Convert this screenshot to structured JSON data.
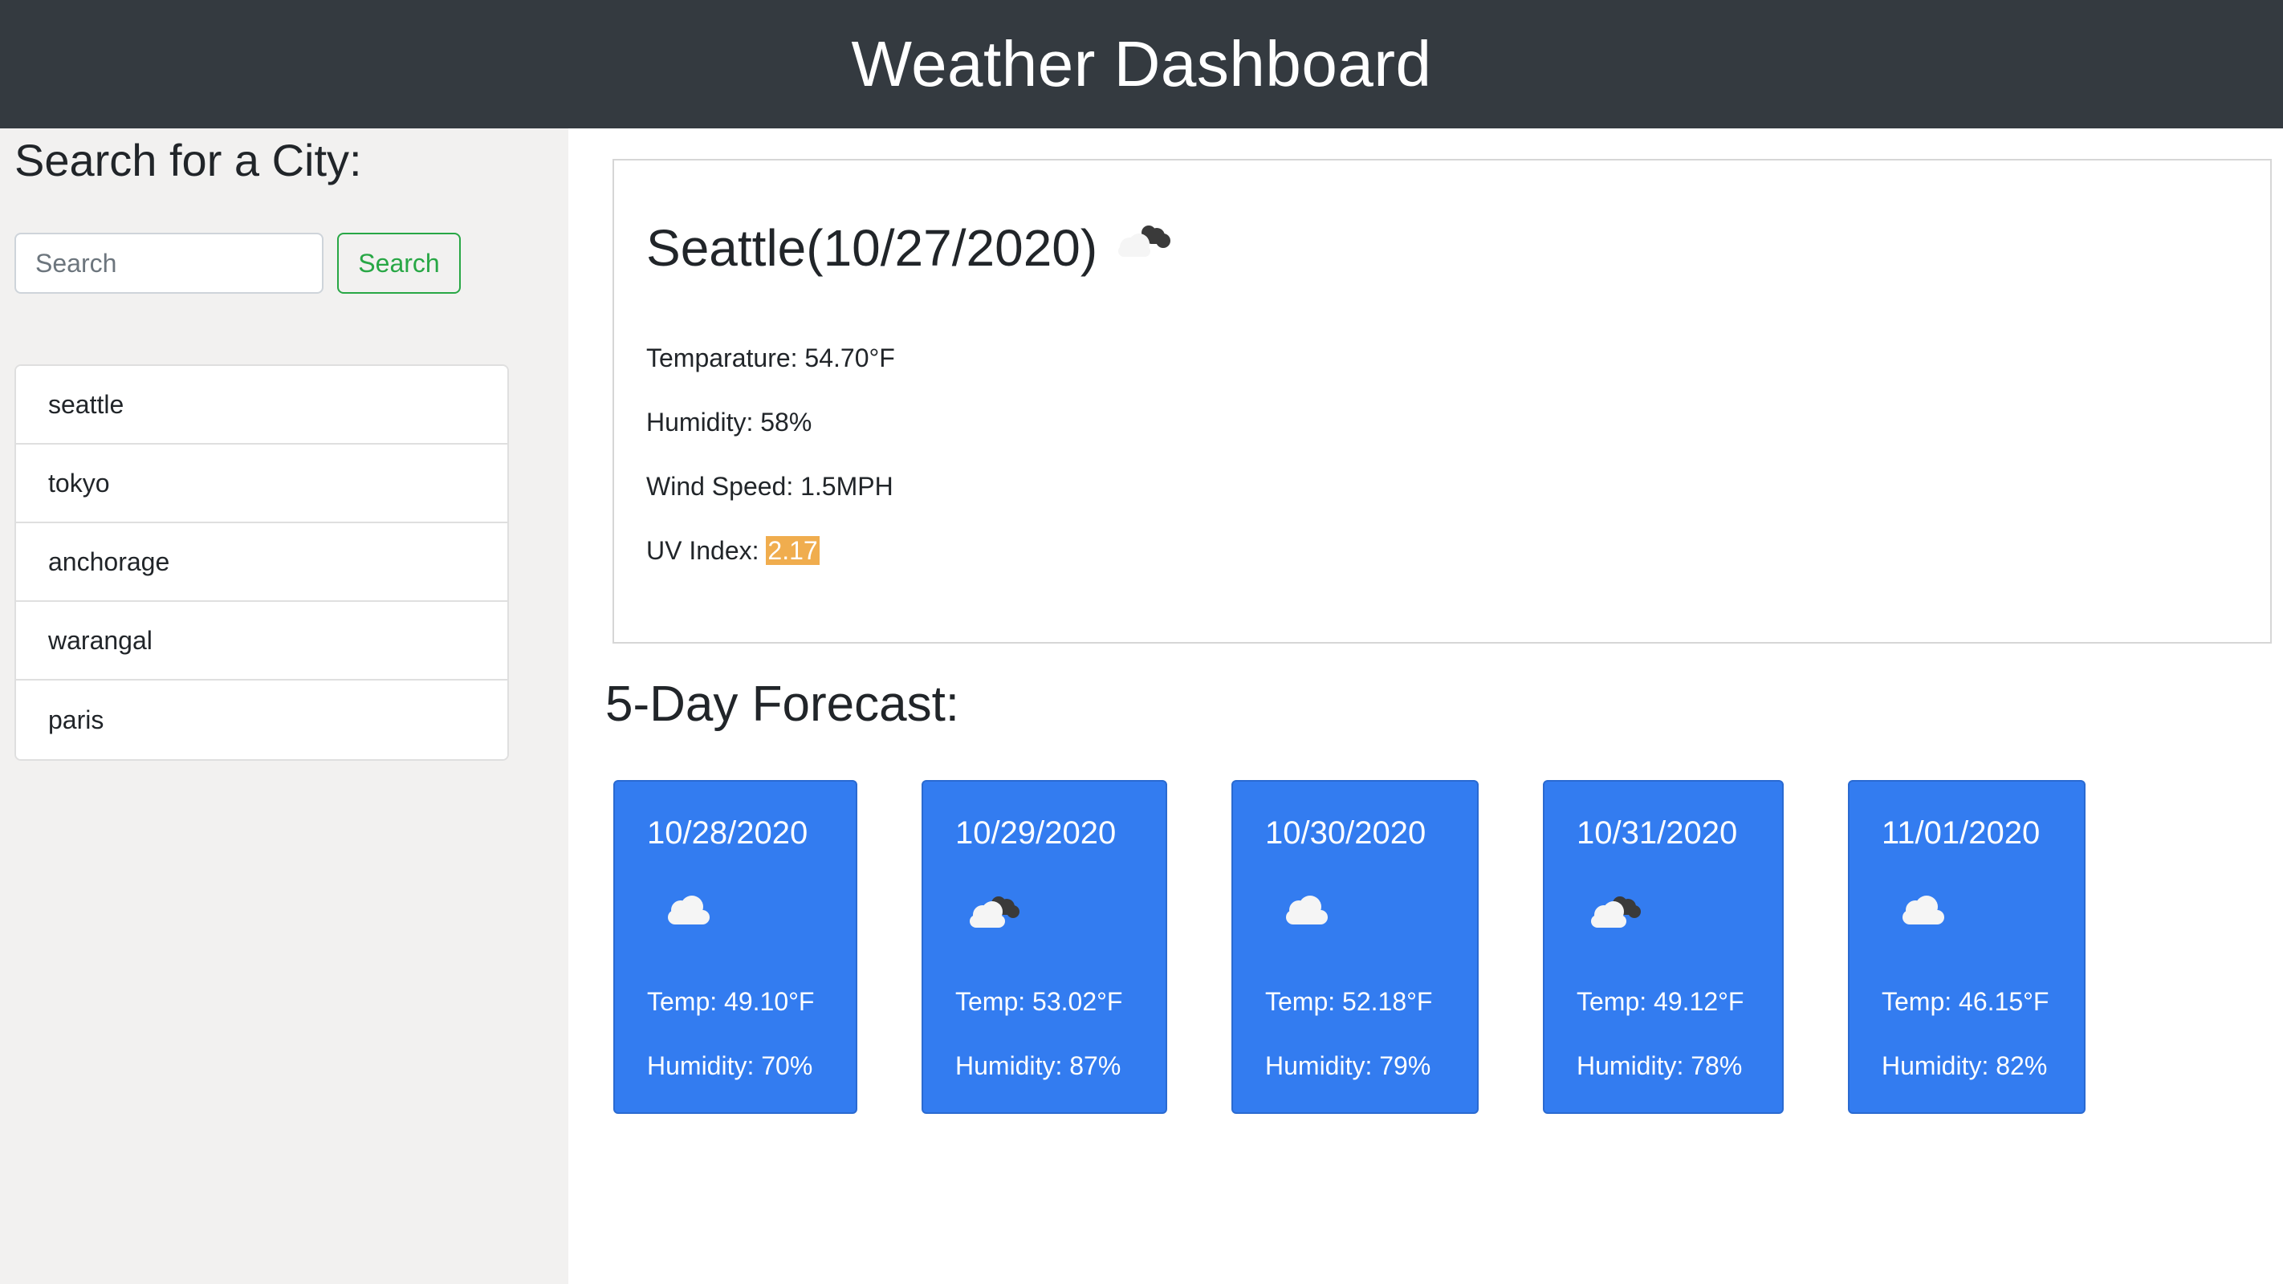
{
  "header": {
    "title": "Weather Dashboard"
  },
  "sidebar": {
    "heading": "Search for a City:",
    "search_placeholder": "Search",
    "search_button": "Search",
    "cities": [
      "seattle",
      "tokyo",
      "anchorage",
      "warangal",
      "paris"
    ]
  },
  "current": {
    "title": "Seattle(10/27/2020)",
    "icon": "broken-clouds-icon",
    "temperature": "Temparature: 54.70°F",
    "humidity": "Humidity: 58%",
    "wind": "Wind Speed: 1.5MPH",
    "uv_label": "UV Index: ",
    "uv_value": "2.17",
    "uv_color": "#f0ad4e"
  },
  "forecast": {
    "heading": "5-Day Forecast:",
    "accent": "#337cf0",
    "days": [
      {
        "date": "10/28/2020",
        "icon": "cloud-icon",
        "temp": "Temp: 49.10°F",
        "humidity": "Humidity: 70%"
      },
      {
        "date": "10/29/2020",
        "icon": "broken-clouds-icon",
        "temp": "Temp: 53.02°F",
        "humidity": "Humidity: 87%"
      },
      {
        "date": "10/30/2020",
        "icon": "cloud-icon",
        "temp": "Temp: 52.18°F",
        "humidity": "Humidity: 79%"
      },
      {
        "date": "10/31/2020",
        "icon": "broken-clouds-icon",
        "temp": "Temp: 49.12°F",
        "humidity": "Humidity: 78%"
      },
      {
        "date": "11/01/2020",
        "icon": "cloud-icon",
        "temp": "Temp: 46.15°F",
        "humidity": "Humidity: 82%"
      }
    ]
  }
}
